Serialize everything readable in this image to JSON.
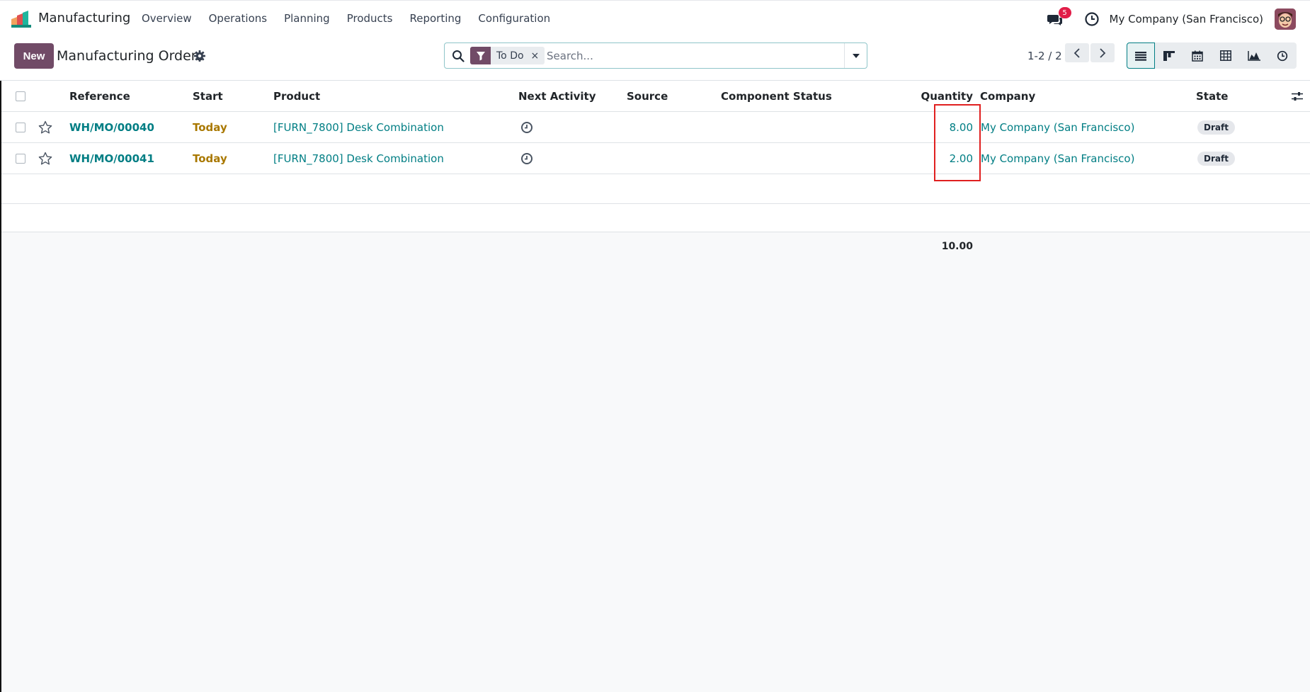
{
  "navbar": {
    "app_name": "Manufacturing",
    "menu": [
      "Overview",
      "Operations",
      "Planning",
      "Products",
      "Reporting",
      "Configuration"
    ],
    "messages_count": "5",
    "company": "My Company (San Francisco)",
    "icons": [
      "app-logo-icon",
      "chat-icon",
      "clock-icon",
      "avatar"
    ]
  },
  "control_panel": {
    "new_label": "New",
    "title": "Manufacturing Orders",
    "search": {
      "facet_label": "To Do",
      "facet_remove": "×",
      "placeholder": "Search..."
    },
    "pager": "1-2 / 2",
    "views": [
      "list",
      "kanban",
      "calendar",
      "pivot",
      "graph",
      "activity"
    ],
    "active_view": "list"
  },
  "table": {
    "columns": {
      "reference": "Reference",
      "start": "Start",
      "product": "Product",
      "next_activity": "Next Activity",
      "source": "Source",
      "component_status": "Component Status",
      "quantity": "Quantity",
      "company": "Company",
      "state": "State"
    },
    "rows": [
      {
        "reference": "WH/MO/00040",
        "start": "Today",
        "product": "[FURN_7800] Desk Combination",
        "source": "",
        "component_status": "",
        "quantity": "8.00",
        "company": "My Company (San Francisco)",
        "state": "Draft"
      },
      {
        "reference": "WH/MO/00041",
        "start": "Today",
        "product": "[FURN_7800] Desk Combination",
        "source": "",
        "component_status": "",
        "quantity": "2.00",
        "company": "My Company (San Francisco)",
        "state": "Draft"
      }
    ],
    "total_quantity": "10.00"
  },
  "colors": {
    "brand": "#714b67",
    "link": "#017e84",
    "today": "#a97800",
    "badge": "#e11d48",
    "highlight": "#e02020"
  }
}
